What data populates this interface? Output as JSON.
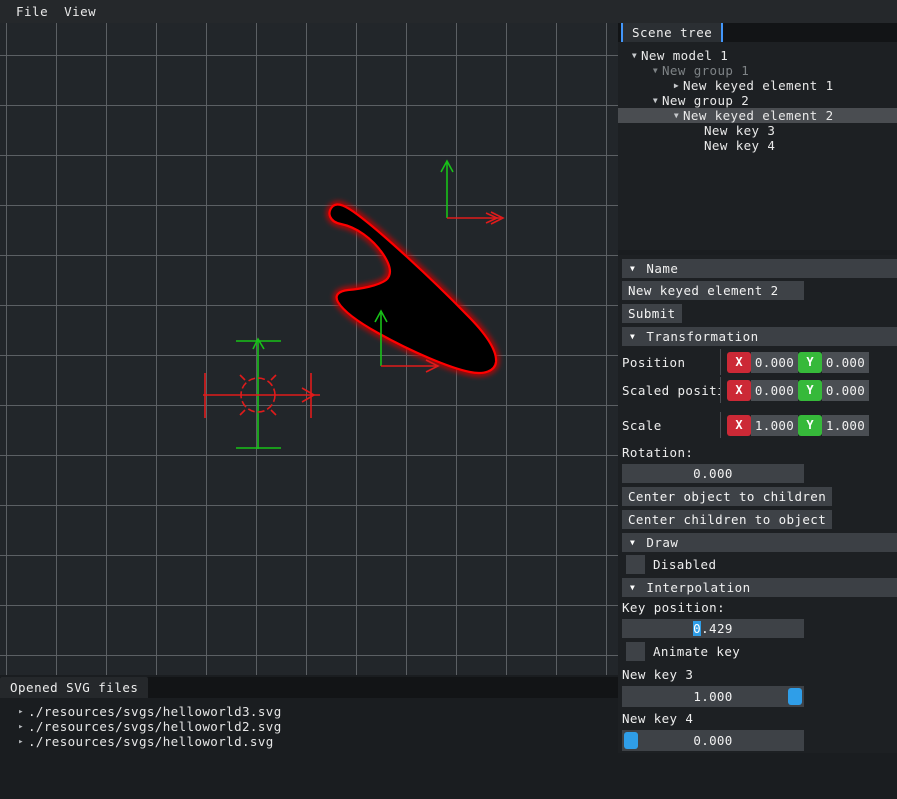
{
  "menubar": {
    "items": [
      {
        "label": "File"
      },
      {
        "label": "View"
      }
    ]
  },
  "viewport": {
    "grid_color": "#8d9194",
    "background": "#22262a",
    "shape_fill": "#000000",
    "shape_outline": "#ff0000",
    "gizmo_x_color": "#e01b1b",
    "gizmo_y_color": "#18c218"
  },
  "scene_tree": {
    "tab_label": "Scene tree",
    "tab_accent": "#4296fa",
    "nodes": [
      {
        "label": "New model 1",
        "indent": 0,
        "arrow": "down",
        "dim": false,
        "selected": false
      },
      {
        "label": "New group 1",
        "indent": 1,
        "arrow": "down",
        "dim": true,
        "selected": false
      },
      {
        "label": "New keyed element 1",
        "indent": 2,
        "arrow": "right",
        "dim": false,
        "selected": false
      },
      {
        "label": "New group 2",
        "indent": 1,
        "arrow": "down",
        "dim": false,
        "selected": false
      },
      {
        "label": "New keyed element 2",
        "indent": 2,
        "arrow": "down",
        "dim": false,
        "selected": true
      },
      {
        "label": "New key 3",
        "indent": 3,
        "arrow": "none",
        "dim": false,
        "selected": false
      },
      {
        "label": "New key 4",
        "indent": 3,
        "arrow": "none",
        "dim": false,
        "selected": false
      }
    ]
  },
  "properties": {
    "name_section": {
      "header": "Name",
      "name_value": "New keyed element 2",
      "submit_label": "Submit"
    },
    "transformation_section": {
      "header": "Transformation",
      "position": {
        "label": "Position",
        "x_badge": "X",
        "x_value": "0.000",
        "y_badge": "Y",
        "y_value": "0.000"
      },
      "scaled_position": {
        "label": "Scaled positi",
        "x_badge": "X",
        "x_value": "0.000",
        "y_badge": "Y",
        "y_value": "0.000"
      },
      "scale": {
        "label": "Scale",
        "x_badge": "X",
        "x_value": "1.000",
        "y_badge": "Y",
        "y_value": "1.000"
      },
      "rotation_label": "Rotation:",
      "rotation_value": "0.000",
      "center_object_to_children": "Center object to children",
      "center_children_to_object": "Center children to object"
    },
    "draw_section": {
      "header": "Draw",
      "disabled_label": "Disabled",
      "disabled_checked": false
    },
    "interpolation_section": {
      "header": "Interpolation",
      "key_position_label": "Key position:",
      "key_position_selected": "0",
      "key_position_rest": ".429",
      "animate_key_label": "Animate key",
      "animate_key_checked": false,
      "keys": [
        {
          "label": "New key 3",
          "value": "1.000",
          "fraction": 1.0
        },
        {
          "label": "New key 4",
          "value": "0.000",
          "fraction": 0.0
        }
      ]
    }
  },
  "files_panel": {
    "tab_label": "Opened SVG files",
    "files": [
      {
        "path": "./resources/svgs/helloworld3.svg"
      },
      {
        "path": "./resources/svgs/helloworld2.svg"
      },
      {
        "path": "./resources/svgs/helloworld.svg"
      }
    ]
  }
}
